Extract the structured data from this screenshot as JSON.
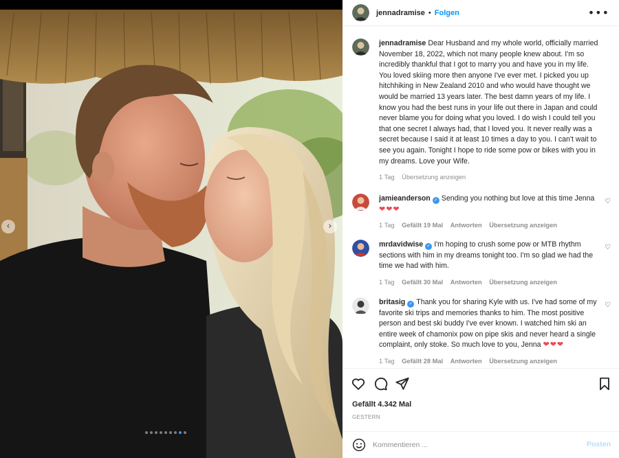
{
  "post": {
    "author": "jennadramise",
    "separator": "•",
    "follow_label": "Folgen",
    "more_icon": "more-horizontal-icon"
  },
  "caption": {
    "username": "jennadramise",
    "text": "Dear Husband and my whole world, officially married November 18, 2022, which not many people knew about. I'm so incredibly thankful that I got to marry you and have you in my life. You loved skiing more then anyone I've ever met. I picked you up hitchhiking in New Zealand 2010 and who would have thought we would be married 13 years later. The best damn years of my life. I know you had the best runs in your life out there in Japan and could never blame you for doing what you loved. I do wish I could tell you that one secret I always had, that I loved you. It never really was a secret because I said it at least 10 times a day to you. I can't wait to see you again. Tonight I hope to ride some pow or bikes with you in my dreams. Love your Wife.",
    "time": "1 Tag",
    "translate": "Übersetzung anzeigen"
  },
  "comments": [
    {
      "username": "jamieanderson",
      "verified": true,
      "text": "Sending you nothing but love at this time Jenna",
      "hearts": "❤❤❤",
      "time": "1 Tag",
      "likes": "Gefällt 19 Mal",
      "reply": "Antworten",
      "translate": "Übersetzung anzeigen"
    },
    {
      "username": "mrdavidwise",
      "verified": true,
      "text": "I'm hoping to crush some pow or MTB rhythm sections with him in my dreams tonight too. I'm so glad we had the time we had with him.",
      "hearts": "",
      "time": "1 Tag",
      "likes": "Gefällt 30 Mal",
      "reply": "Antworten",
      "translate": "Übersetzung anzeigen"
    },
    {
      "username": "britasig",
      "verified": true,
      "text": "Thank you for sharing Kyle with us. I've had some of my favorite ski trips and memories thanks to him. The most positive person and best ski buddy I've ever known. I watched him ski an entire week of chamonix pow on pipe skis and never heard a single complaint, only stoke. So much love to you, Jenna",
      "hearts": "❤❤❤",
      "time": "1 Tag",
      "likes": "Gefällt 28 Mal",
      "reply": "Antworten",
      "translate": "Übersetzung anzeigen"
    }
  ],
  "actions": {
    "icons": [
      "heart-icon",
      "comment-icon",
      "share-icon",
      "bookmark-icon"
    ],
    "likes": "Gefällt 4.342 Mal",
    "date": "GESTERN"
  },
  "comment_box": {
    "placeholder": "Kommentieren ...",
    "post_label": "Posten"
  },
  "carousel": {
    "slide_count": 9,
    "active_index": 7
  },
  "colors": {
    "accent": "#0095f6",
    "verified": "#3897f0",
    "heart": "#ed4956",
    "muted": "#8e8e8e",
    "post_disabled": "#b2dffc"
  }
}
